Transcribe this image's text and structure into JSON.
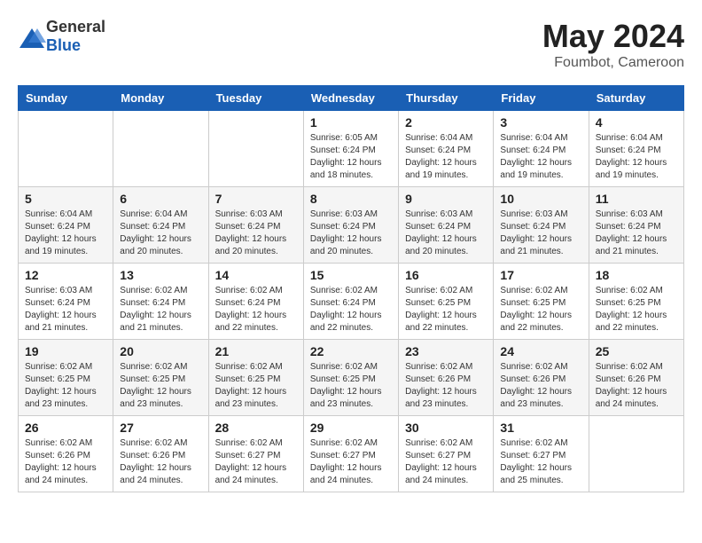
{
  "header": {
    "logo_general": "General",
    "logo_blue": "Blue",
    "month_title": "May 2024",
    "location": "Foumbot, Cameroon"
  },
  "weekdays": [
    "Sunday",
    "Monday",
    "Tuesday",
    "Wednesday",
    "Thursday",
    "Friday",
    "Saturday"
  ],
  "weeks": [
    [
      {
        "day": "",
        "info": ""
      },
      {
        "day": "",
        "info": ""
      },
      {
        "day": "",
        "info": ""
      },
      {
        "day": "1",
        "info": "Sunrise: 6:05 AM\nSunset: 6:24 PM\nDaylight: 12 hours\nand 18 minutes."
      },
      {
        "day": "2",
        "info": "Sunrise: 6:04 AM\nSunset: 6:24 PM\nDaylight: 12 hours\nand 19 minutes."
      },
      {
        "day": "3",
        "info": "Sunrise: 6:04 AM\nSunset: 6:24 PM\nDaylight: 12 hours\nand 19 minutes."
      },
      {
        "day": "4",
        "info": "Sunrise: 6:04 AM\nSunset: 6:24 PM\nDaylight: 12 hours\nand 19 minutes."
      }
    ],
    [
      {
        "day": "5",
        "info": "Sunrise: 6:04 AM\nSunset: 6:24 PM\nDaylight: 12 hours\nand 19 minutes."
      },
      {
        "day": "6",
        "info": "Sunrise: 6:04 AM\nSunset: 6:24 PM\nDaylight: 12 hours\nand 20 minutes."
      },
      {
        "day": "7",
        "info": "Sunrise: 6:03 AM\nSunset: 6:24 PM\nDaylight: 12 hours\nand 20 minutes."
      },
      {
        "day": "8",
        "info": "Sunrise: 6:03 AM\nSunset: 6:24 PM\nDaylight: 12 hours\nand 20 minutes."
      },
      {
        "day": "9",
        "info": "Sunrise: 6:03 AM\nSunset: 6:24 PM\nDaylight: 12 hours\nand 20 minutes."
      },
      {
        "day": "10",
        "info": "Sunrise: 6:03 AM\nSunset: 6:24 PM\nDaylight: 12 hours\nand 21 minutes."
      },
      {
        "day": "11",
        "info": "Sunrise: 6:03 AM\nSunset: 6:24 PM\nDaylight: 12 hours\nand 21 minutes."
      }
    ],
    [
      {
        "day": "12",
        "info": "Sunrise: 6:03 AM\nSunset: 6:24 PM\nDaylight: 12 hours\nand 21 minutes."
      },
      {
        "day": "13",
        "info": "Sunrise: 6:02 AM\nSunset: 6:24 PM\nDaylight: 12 hours\nand 21 minutes."
      },
      {
        "day": "14",
        "info": "Sunrise: 6:02 AM\nSunset: 6:24 PM\nDaylight: 12 hours\nand 22 minutes."
      },
      {
        "day": "15",
        "info": "Sunrise: 6:02 AM\nSunset: 6:24 PM\nDaylight: 12 hours\nand 22 minutes."
      },
      {
        "day": "16",
        "info": "Sunrise: 6:02 AM\nSunset: 6:25 PM\nDaylight: 12 hours\nand 22 minutes."
      },
      {
        "day": "17",
        "info": "Sunrise: 6:02 AM\nSunset: 6:25 PM\nDaylight: 12 hours\nand 22 minutes."
      },
      {
        "day": "18",
        "info": "Sunrise: 6:02 AM\nSunset: 6:25 PM\nDaylight: 12 hours\nand 22 minutes."
      }
    ],
    [
      {
        "day": "19",
        "info": "Sunrise: 6:02 AM\nSunset: 6:25 PM\nDaylight: 12 hours\nand 23 minutes."
      },
      {
        "day": "20",
        "info": "Sunrise: 6:02 AM\nSunset: 6:25 PM\nDaylight: 12 hours\nand 23 minutes."
      },
      {
        "day": "21",
        "info": "Sunrise: 6:02 AM\nSunset: 6:25 PM\nDaylight: 12 hours\nand 23 minutes."
      },
      {
        "day": "22",
        "info": "Sunrise: 6:02 AM\nSunset: 6:25 PM\nDaylight: 12 hours\nand 23 minutes."
      },
      {
        "day": "23",
        "info": "Sunrise: 6:02 AM\nSunset: 6:26 PM\nDaylight: 12 hours\nand 23 minutes."
      },
      {
        "day": "24",
        "info": "Sunrise: 6:02 AM\nSunset: 6:26 PM\nDaylight: 12 hours\nand 23 minutes."
      },
      {
        "day": "25",
        "info": "Sunrise: 6:02 AM\nSunset: 6:26 PM\nDaylight: 12 hours\nand 24 minutes."
      }
    ],
    [
      {
        "day": "26",
        "info": "Sunrise: 6:02 AM\nSunset: 6:26 PM\nDaylight: 12 hours\nand 24 minutes."
      },
      {
        "day": "27",
        "info": "Sunrise: 6:02 AM\nSunset: 6:26 PM\nDaylight: 12 hours\nand 24 minutes."
      },
      {
        "day": "28",
        "info": "Sunrise: 6:02 AM\nSunset: 6:27 PM\nDaylight: 12 hours\nand 24 minutes."
      },
      {
        "day": "29",
        "info": "Sunrise: 6:02 AM\nSunset: 6:27 PM\nDaylight: 12 hours\nand 24 minutes."
      },
      {
        "day": "30",
        "info": "Sunrise: 6:02 AM\nSunset: 6:27 PM\nDaylight: 12 hours\nand 24 minutes."
      },
      {
        "day": "31",
        "info": "Sunrise: 6:02 AM\nSunset: 6:27 PM\nDaylight: 12 hours\nand 25 minutes."
      },
      {
        "day": "",
        "info": ""
      }
    ]
  ]
}
